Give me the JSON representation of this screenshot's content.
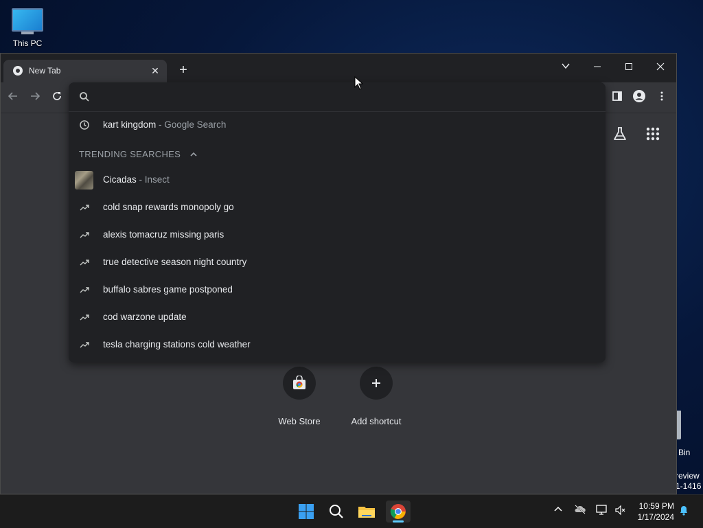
{
  "desktop": {
    "this_pc_label": "This PC",
    "recycle_label": "Bin",
    "watermark_lines": [
      "review",
      "1-1416"
    ]
  },
  "browser": {
    "tab_title": "New Tab",
    "omnibox": {
      "input_value": "",
      "history_item": {
        "query": "kart kingdom",
        "suffix": " - Google Search"
      },
      "trending_header": "TRENDING SEARCHES",
      "trending": [
        {
          "text": "Cicadas",
          "suffix": " - Insect",
          "has_thumb": true
        },
        {
          "text": "cold snap rewards monopoly go"
        },
        {
          "text": "alexis tomacruz missing paris"
        },
        {
          "text": "true detective season night country"
        },
        {
          "text": "buffalo sabres game postponed"
        },
        {
          "text": "cod warzone update"
        },
        {
          "text": "tesla charging stations cold weather"
        }
      ]
    },
    "shortcuts": [
      {
        "label": "Web Store"
      },
      {
        "label": "Add shortcut"
      }
    ]
  },
  "taskbar": {
    "time": "10:59 PM",
    "date": "1/17/2024"
  },
  "colors": {
    "accent": "#8ab4f8",
    "window_bg": "#35363a",
    "dropdown_bg": "#202124"
  }
}
